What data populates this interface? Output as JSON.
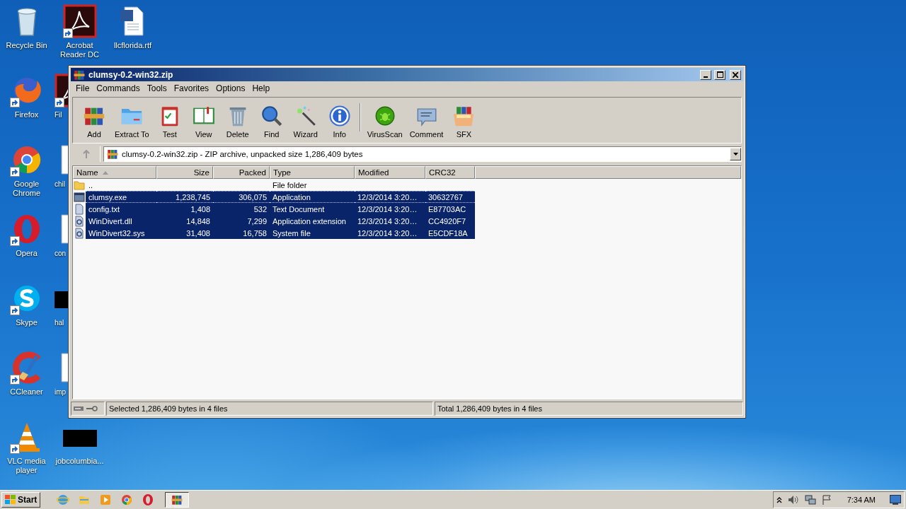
{
  "desktop_icons": [
    {
      "label": "Recycle Bin",
      "kind": "recycle",
      "shortcut": false,
      "cut": false
    },
    {
      "label": "Firefox",
      "kind": "firefox",
      "shortcut": true,
      "cut": false
    },
    {
      "label": "Google Chrome",
      "kind": "chrome",
      "shortcut": true,
      "cut": false
    },
    {
      "label": "Opera",
      "kind": "opera",
      "shortcut": true,
      "cut": false
    },
    {
      "label": "Skype",
      "kind": "skype",
      "shortcut": true,
      "cut": false
    },
    {
      "label": "CCleaner",
      "kind": "ccleaner",
      "shortcut": true,
      "cut": false
    },
    {
      "label": "VLC media player",
      "kind": "vlc",
      "shortcut": true,
      "cut": false
    },
    {
      "label": "Acrobat Reader DC",
      "kind": "acrobat",
      "shortcut": true,
      "cut": false
    },
    {
      "label": "Fil",
      "kind": "acrobat",
      "shortcut": true,
      "cut": true
    },
    {
      "label": "chil",
      "kind": "doc",
      "shortcut": false,
      "cut": true
    },
    {
      "label": "con",
      "kind": "doc",
      "shortcut": false,
      "cut": true
    },
    {
      "label": "hal",
      "kind": "blank",
      "shortcut": false,
      "cut": true
    },
    {
      "label": "imp",
      "kind": "doc",
      "shortcut": false,
      "cut": true
    },
    {
      "label": "jobcolumbia...",
      "kind": "blank",
      "shortcut": false,
      "cut": false
    },
    {
      "label": "llcflorida.rtf",
      "kind": "word",
      "shortcut": false,
      "cut": false
    }
  ],
  "window": {
    "title": "clumsy-0.2-win32.zip",
    "menu": [
      "File",
      "Commands",
      "Tools",
      "Favorites",
      "Options",
      "Help"
    ],
    "toolbar_groups": [
      {
        "buttons": [
          {
            "label": "Add",
            "kind": "add"
          },
          {
            "label": "Extract To",
            "kind": "extract"
          },
          {
            "label": "Test",
            "kind": "test"
          },
          {
            "label": "View",
            "kind": "view"
          },
          {
            "label": "Delete",
            "kind": "delete"
          },
          {
            "label": "Find",
            "kind": "find"
          },
          {
            "label": "Wizard",
            "kind": "wizard"
          },
          {
            "label": "Info",
            "kind": "info"
          }
        ]
      },
      {
        "buttons": [
          {
            "label": "VirusScan",
            "kind": "virus"
          },
          {
            "label": "Comment",
            "kind": "comment"
          },
          {
            "label": "SFX",
            "kind": "sfx"
          }
        ]
      }
    ],
    "address": "clumsy-0.2-win32.zip - ZIP archive, unpacked size 1,286,409 bytes",
    "columns": [
      {
        "label": "Name",
        "kind": "text",
        "sorted": true
      },
      {
        "label": "Size",
        "kind": "number",
        "sorted": false
      },
      {
        "label": "Packed",
        "kind": "number",
        "sorted": false
      },
      {
        "label": "Type",
        "kind": "text",
        "sorted": false
      },
      {
        "label": "Modified",
        "kind": "text",
        "sorted": false
      },
      {
        "label": "CRC32",
        "kind": "text",
        "sorted": false
      }
    ],
    "files": [
      {
        "kind": "folder",
        "name": "..",
        "type": "File folder",
        "selected": false,
        "focused": false
      },
      {
        "kind": "exe",
        "name": "clumsy.exe",
        "size": "1,238,745",
        "packed": "306,075",
        "type": "Application",
        "modified": "12/3/2014 3:20…",
        "crc32": "30632767",
        "selected": true,
        "focused": true
      },
      {
        "kind": "txt",
        "name": "config.txt",
        "size": "1,408",
        "packed": "532",
        "type": "Text Document",
        "modified": "12/3/2014 3:20…",
        "crc32": "E87703AC",
        "selected": true,
        "focused": false
      },
      {
        "kind": "dll",
        "name": "WinDivert.dll",
        "size": "14,848",
        "packed": "7,299",
        "type": "Application extension",
        "modified": "12/3/2014 3:20…",
        "crc32": "CC4920F7",
        "selected": true,
        "focused": false
      },
      {
        "kind": "dll",
        "name": "WinDivert32.sys",
        "size": "31,408",
        "packed": "16,758",
        "type": "System file",
        "modified": "12/3/2014 3:20…",
        "crc32": "E5CDF18A",
        "selected": true,
        "focused": false
      }
    ],
    "status_left": "Selected 1,286,409 bytes in 4 files",
    "status_right": "Total 1,286,409 bytes in 4 files"
  },
  "taskbar": {
    "start": "Start",
    "apps": [
      {
        "kind": "ie",
        "active": false
      },
      {
        "kind": "explorer",
        "active": false
      },
      {
        "kind": "media",
        "active": false
      },
      {
        "kind": "chrome",
        "active": false
      },
      {
        "kind": "opera",
        "active": false
      },
      {
        "kind": "winrar",
        "active": true
      }
    ],
    "time": "7:34 AM"
  }
}
